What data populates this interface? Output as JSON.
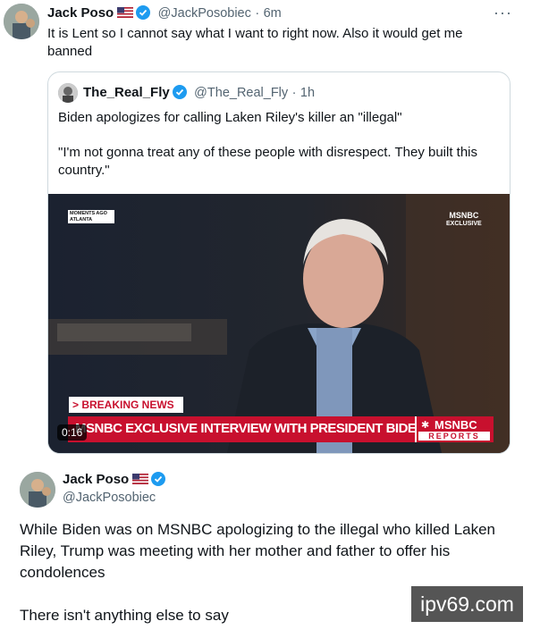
{
  "tweet1": {
    "author_name": "Jack Poso",
    "handle": "@JackPosobiec",
    "separator": "·",
    "time": "6m",
    "text": "It is Lent so I cannot say what I want to right now. Also it would get me banned",
    "more_icon": "more-icon"
  },
  "quote": {
    "author_name": "The_Real_Fly",
    "handle": "@The_Real_Fly",
    "separator": "·",
    "time": "1h",
    "text_line1": "Biden apologizes for calling Laken Riley's killer an \"illegal\"",
    "text_line2": "\"I'm not gonna treat any of these people with disrespect. They built this country.\"",
    "video": {
      "top_left_bug": "MOMENTS AGO ATLANTA",
      "top_right_bug_line1": "MSNBC",
      "top_right_bug_line2": "EXCLUSIVE",
      "breaking_label": "> BREAKING NEWS",
      "headline": "MSNBC EXCLUSIVE INTERVIEW WITH PRESIDENT BIDEN",
      "brand": "MSNBC",
      "brand_sub": "REPORTS",
      "duration": "0:16"
    }
  },
  "tweet2": {
    "author_name": "Jack Poso",
    "handle": "@JackPosobiec",
    "text_para1": "While Biden was on MSNBC apologizing to the illegal who killed Laken Riley, Trump was meeting with her mother and father to offer his condolences",
    "text_para2": "There isn't anything else to say"
  },
  "watermark": "ipv69.com",
  "colors": {
    "verified": "#1d9bf0",
    "muted": "#536471",
    "msnbc_red": "#c8102e"
  }
}
